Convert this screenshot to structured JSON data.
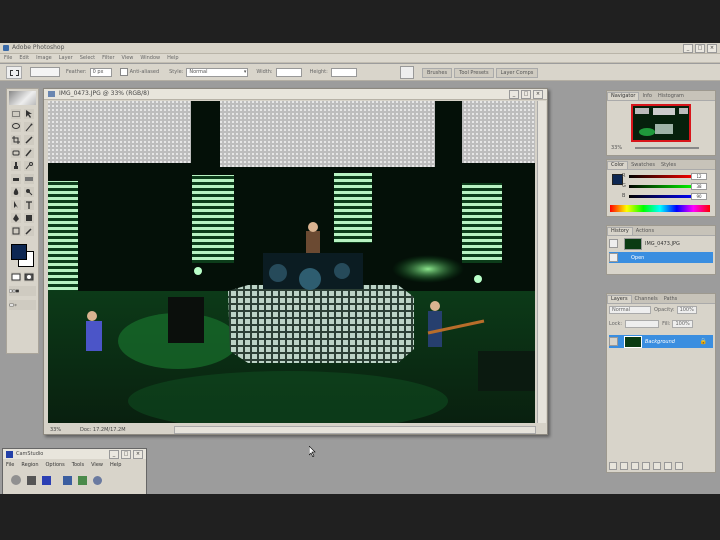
{
  "window": {
    "title": "Adobe Photoshop",
    "min": "_",
    "max": "□",
    "close": "×"
  },
  "menu": [
    "File",
    "Edit",
    "Image",
    "Layer",
    "Select",
    "Filter",
    "View",
    "Window",
    "Help"
  ],
  "options": {
    "feather_label": "Feather:",
    "feather_value": "0 px",
    "antialiased_label": "Anti-aliased",
    "style_label": "Style:",
    "style_value": "Normal",
    "width_label": "Width:",
    "height_label": "Height:"
  },
  "palette_well": [
    "Brushes",
    "Tool Presets",
    "Layer Comps"
  ],
  "document": {
    "title": "IMG_0473.JPG @ 33% (RGB/8)",
    "zoom": "33%",
    "doc_info": "Doc: 17.2M/17.2M"
  },
  "navigator": {
    "tabs": [
      "Navigator",
      "Info",
      "Histogram"
    ],
    "zoom": "33%"
  },
  "color": {
    "tabs": [
      "Color",
      "Swatches",
      "Styles"
    ],
    "sliders": [
      {
        "label": "R",
        "value": "12"
      },
      {
        "label": "G",
        "value": "38"
      },
      {
        "label": "B",
        "value": "90"
      }
    ],
    "fg_color": "#0d2753"
  },
  "history": {
    "tabs": [
      "History",
      "Actions"
    ],
    "items": [
      {
        "label": "IMG_0473.JPG"
      },
      {
        "label": "Open"
      }
    ]
  },
  "layers": {
    "tabs": [
      "Layers",
      "Channels",
      "Paths"
    ],
    "blend_mode": "Normal",
    "opacity_label": "Opacity:",
    "opacity_value": "100%",
    "lock_label": "Lock:",
    "fill_label": "Fill:",
    "fill_value": "100%",
    "layer_name": "Background"
  },
  "camstudio": {
    "title": "CamStudio",
    "menu": [
      "File",
      "Region",
      "Options",
      "Tools",
      "View",
      "Help"
    ]
  },
  "colors": {
    "selection": "#3a8ee0",
    "nav_view_box": "#d8151b"
  }
}
